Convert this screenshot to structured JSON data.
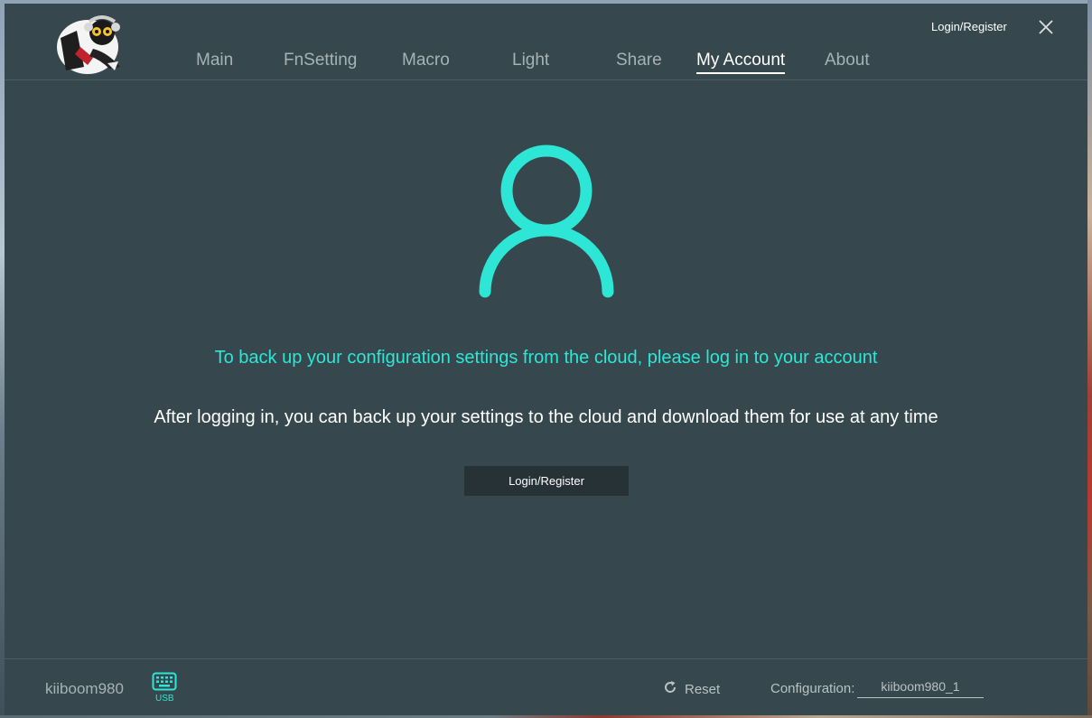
{
  "header": {
    "logo_icon": "mascot-logo-icon",
    "login_register": "Login/Register",
    "close_icon": "close-icon"
  },
  "nav": {
    "tabs": [
      {
        "label": "Main"
      },
      {
        "label": "FnSetting"
      },
      {
        "label": "Macro"
      },
      {
        "label": "Light"
      },
      {
        "label": "Share"
      },
      {
        "label": "My Account",
        "active": true
      },
      {
        "label": "About"
      }
    ]
  },
  "main": {
    "avatar_icon": "user-icon",
    "cloud_message": "To back up your configuration settings from the cloud, please log in to your account",
    "after_message": "After logging in, you can back up your settings to the cloud and download them for use at any time",
    "login_button": "Login/Register"
  },
  "footer": {
    "device_name": "kiiboom980",
    "usb_icon": "keyboard-icon",
    "usb_label": "USB",
    "reset_label": "Reset",
    "reset_icon": "refresh-icon",
    "config_label": "Configuration:",
    "config_value": "kiiboom980_1"
  },
  "colors": {
    "background": "#36474d",
    "accent": "#2ee6d6",
    "button": "#263236",
    "muted_text": "#a7b2b5"
  }
}
